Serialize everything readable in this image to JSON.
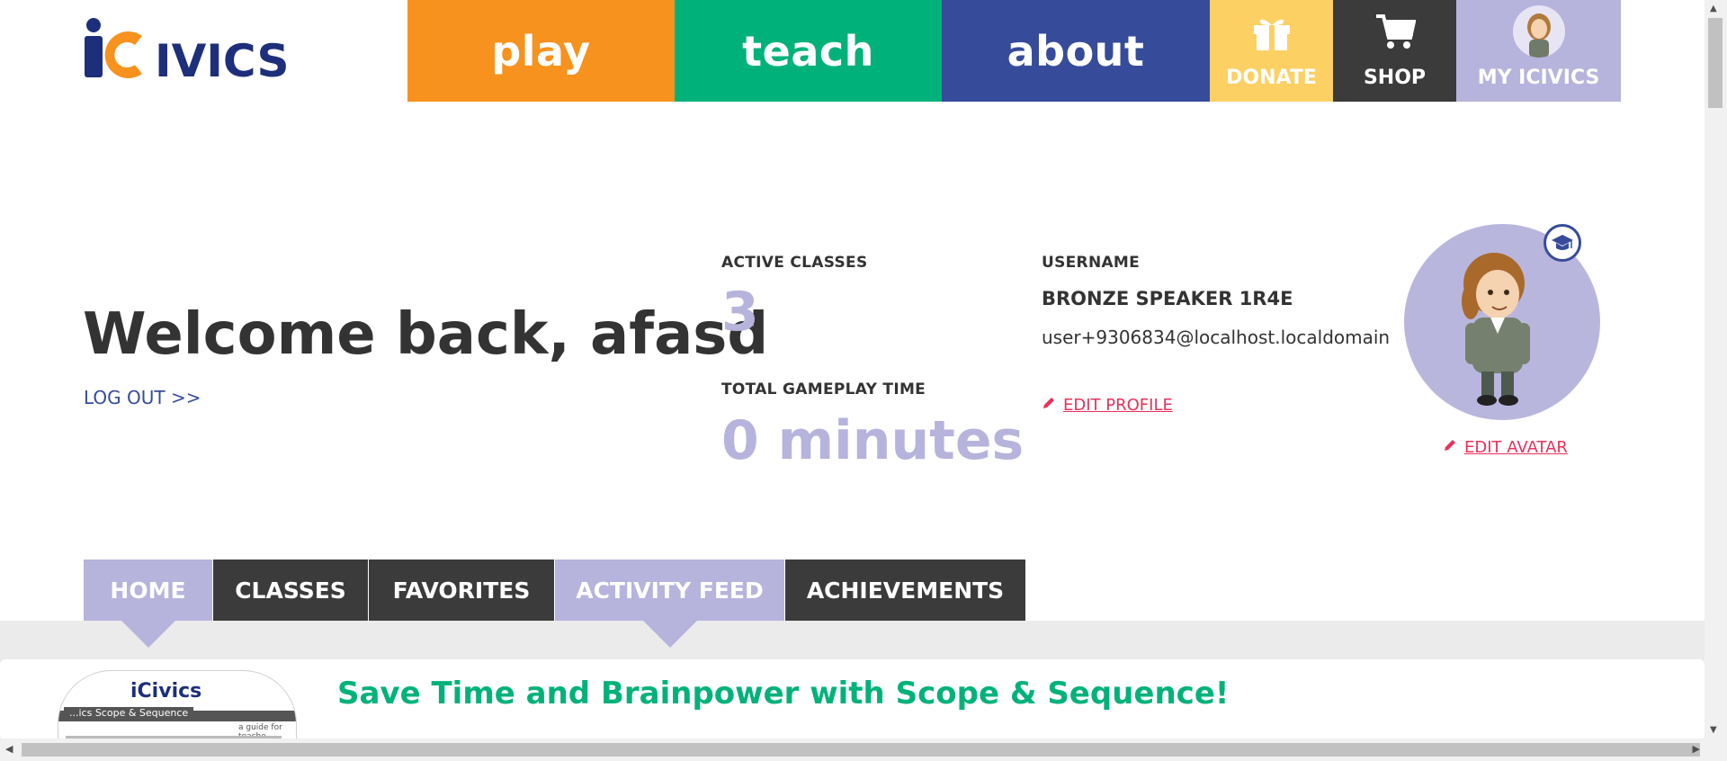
{
  "header": {
    "logo_text": "iCivics",
    "nav": {
      "play": "play",
      "teach": "teach",
      "about": "about",
      "donate": "DONATE",
      "shop": "SHOP",
      "my_icivics": "MY ICIVICS"
    },
    "colors": {
      "play": "#f7921e",
      "teach": "#00b27a",
      "about": "#364c9a",
      "donate": "#fdd064",
      "shop": "#3b3b3b",
      "my_icivics": "#b6b3dd"
    }
  },
  "profile": {
    "welcome": "Welcome back, afasd",
    "logout": "LOG OUT >>",
    "active_classes_label": "ACTIVE CLASSES",
    "active_classes_value": "3",
    "gameplay_label": "TOTAL GAMEPLAY TIME",
    "gameplay_value": "0 minutes",
    "username_label": "USERNAME",
    "username_value": "BRONZE SPEAKER 1R4E",
    "email": "user+9306834@localhost.localdomain",
    "edit_profile": "EDIT PROFILE",
    "edit_avatar": "EDIT AVATAR"
  },
  "tabs": [
    {
      "label": "HOME",
      "active": true
    },
    {
      "label": "CLASSES",
      "active": false
    },
    {
      "label": "FAVORITES",
      "active": false
    },
    {
      "label": "ACTIVITY FEED",
      "active": true
    },
    {
      "label": "ACHIEVEMENTS",
      "active": false
    }
  ],
  "feed": {
    "thumbnail_logo": "iCivics",
    "thumbnail_title": "...ics Scope & Sequence",
    "thumbnail_subtitle": "a guide for teache...",
    "title": "Save Time and Brainpower with Scope & Sequence!"
  }
}
